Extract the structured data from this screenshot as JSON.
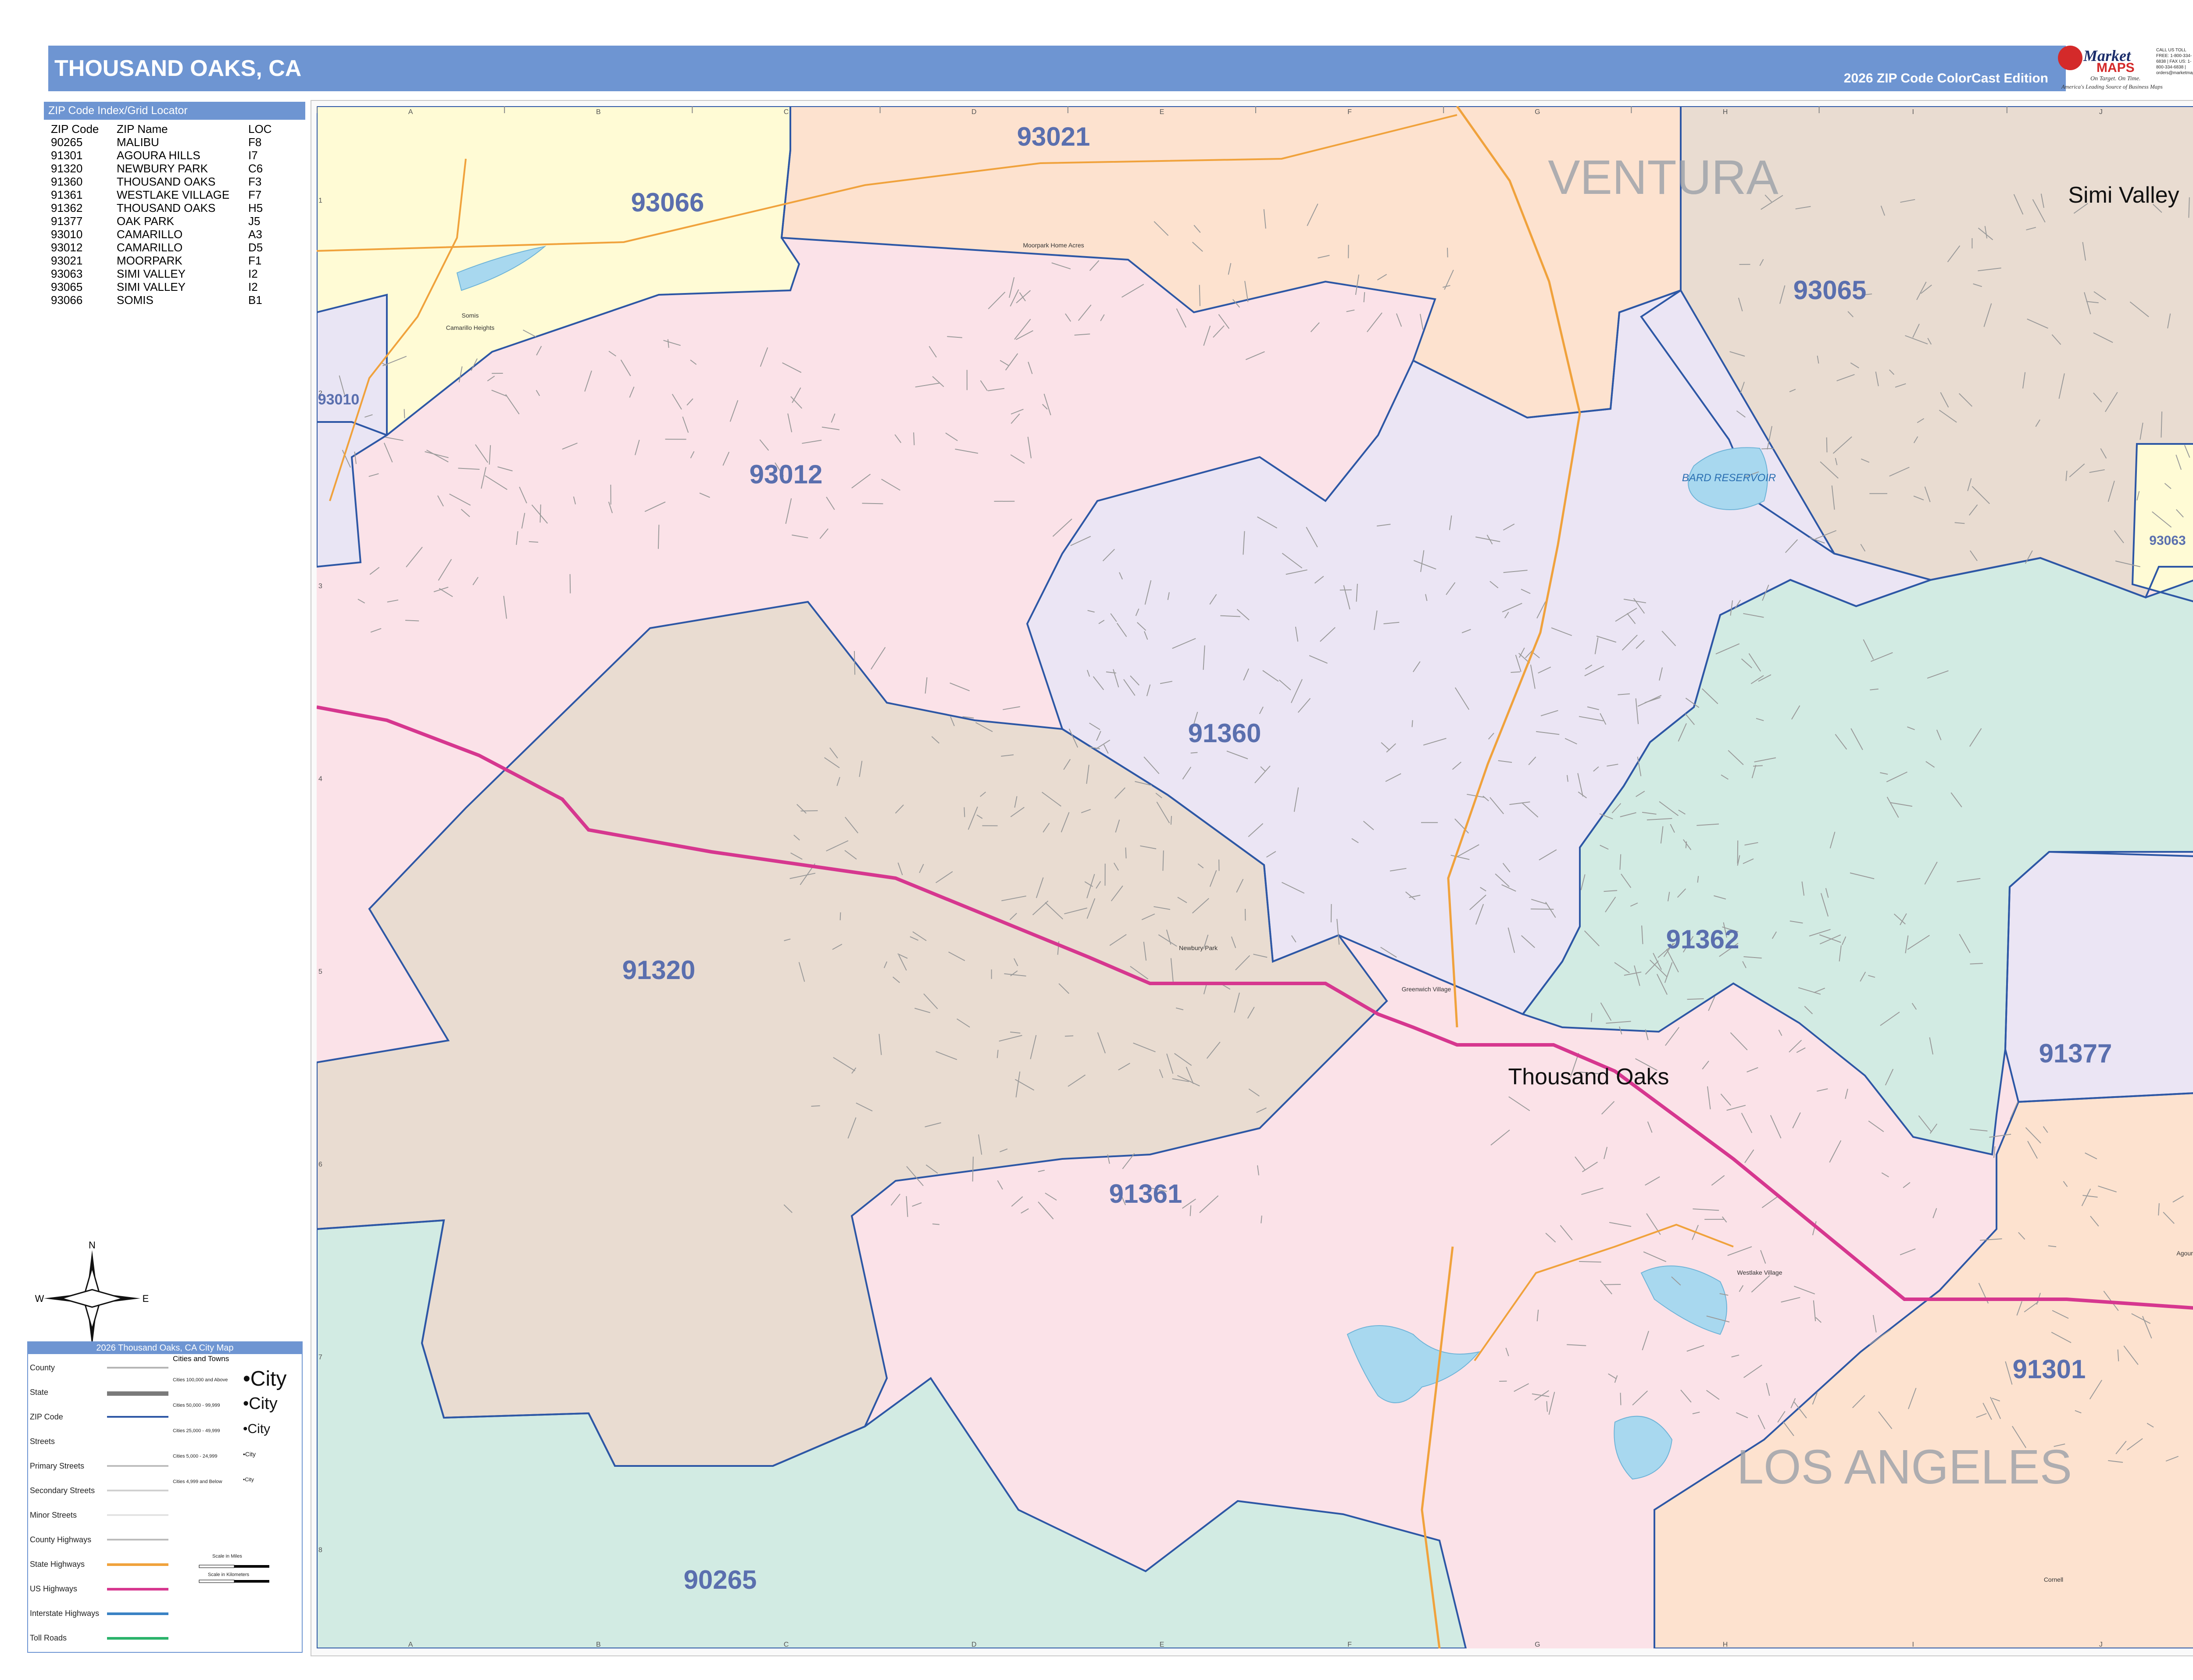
{
  "header": {
    "title": "THOUSAND OAKS, CA",
    "edition": "2026 ZIP Code ColorCast Edition"
  },
  "brand": {
    "logo_word": "Market",
    "logo_maps": "MAPS",
    "tagline": "On Target. On Time.",
    "tagline2": "America's Leading Source of Business Maps",
    "contact": "CALL US TOLL FREE: 1-800-334-6838 | FAX US: 1-800-334-6838 | orders@marketmaps.com"
  },
  "index": {
    "header": "ZIP Code Index/Grid Locator",
    "columns": [
      "ZIP Code",
      "ZIP Name",
      "LOC"
    ],
    "rows": [
      [
        "90265",
        "MALIBU",
        "F8"
      ],
      [
        "91301",
        "AGOURA HILLS",
        "I7"
      ],
      [
        "91320",
        "NEWBURY PARK",
        "C6"
      ],
      [
        "91360",
        "THOUSAND OAKS",
        "F3"
      ],
      [
        "91361",
        "WESTLAKE VILLAGE",
        "F7"
      ],
      [
        "91362",
        "THOUSAND OAKS",
        "H5"
      ],
      [
        "91377",
        "OAK PARK",
        "J5"
      ],
      [
        "93010",
        "CAMARILLO",
        "A3"
      ],
      [
        "93012",
        "CAMARILLO",
        "D5"
      ],
      [
        "93021",
        "MOORPARK",
        "F1"
      ],
      [
        "93063",
        "SIMI VALLEY",
        "I2"
      ],
      [
        "93065",
        "SIMI VALLEY",
        "I2"
      ],
      [
        "93066",
        "SOMIS",
        "B1"
      ]
    ]
  },
  "map": {
    "grid_cols": [
      "A",
      "B",
      "C",
      "D",
      "E",
      "F",
      "G",
      "H",
      "I",
      "J"
    ],
    "grid_rows": [
      "1",
      "2",
      "3",
      "4",
      "5",
      "6",
      "7",
      "8"
    ],
    "zip_labels": [
      {
        "zip": "93021",
        "color": "#5a6fae"
      },
      {
        "zip": "93066",
        "color": "#5a6fae"
      },
      {
        "zip": "93065",
        "color": "#5a6fae"
      },
      {
        "zip": "93010",
        "color": "#5a6fae"
      },
      {
        "zip": "93012",
        "color": "#5a6fae"
      },
      {
        "zip": "93063",
        "color": "#5a6fae"
      },
      {
        "zip": "91360",
        "color": "#5a6fae"
      },
      {
        "zip": "91362",
        "color": "#5a6fae"
      },
      {
        "zip": "91320",
        "color": "#5a6fae"
      },
      {
        "zip": "91377",
        "color": "#5a6fae"
      },
      {
        "zip": "91361",
        "color": "#5a6fae"
      },
      {
        "zip": "91301",
        "color": "#5a6fae"
      },
      {
        "zip": "90265",
        "color": "#5a6fae"
      }
    ],
    "county_labels": [
      "VENTURA",
      "LOS ANGELES"
    ],
    "city_labels": [
      "Simi Valley",
      "Thousand Oaks"
    ],
    "small_places": [
      "Moorpark Home Acres",
      "Somis",
      "Camarillo Heights",
      "Newbury Park",
      "Greenwich Village",
      "Westlake Village",
      "Cornell",
      "Agoura H"
    ],
    "water_labels": [
      "BARD RESERVOIR"
    ],
    "colors": {
      "z93066": "#fffbd5",
      "z93021": "#fde2cf",
      "z93065": "#e9dcd1",
      "z93010": "#e9e5f4",
      "z93012": "#fbe2e8",
      "z93063": "#fffbd5",
      "z91360": "#ebe5f4",
      "z91362": "#d2ebe3",
      "z91320": "#e9dcd1",
      "z91377": "#ebe5f4",
      "z91361": "#fbe2e8",
      "z91301": "#fde2cf",
      "z90265": "#d2ebe3",
      "boundary": "#2d57a5",
      "us_hwy": "#d6378f",
      "state_hwy": "#f0a23c",
      "water": "#a8d8ef"
    }
  },
  "legend": {
    "header": "2026 Thousand Oaks, CA City Map",
    "items": [
      "County",
      "State",
      "ZIP Code",
      "Streets",
      "Primary Streets",
      "Secondary Streets",
      "Minor Streets",
      "County Highways",
      "State Highways",
      "US Highways",
      "Interstate Highways",
      "Toll Roads"
    ],
    "cities_title": "Cities and Towns",
    "city_classes": [
      {
        "label": "Cities 100,000 and Above",
        "sample": "•City"
      },
      {
        "label": "Cities 50,000 - 99,999",
        "sample": "•City"
      },
      {
        "label": "Cities 25,000 - 49,999",
        "sample": "•City"
      },
      {
        "label": "Cities 5,000 - 24,999",
        "sample": "•City"
      },
      {
        "label": "Cities 4,999 and Below",
        "sample": "•City"
      }
    ],
    "scale_miles": "Scale in Miles",
    "scale_km": "Scale in Kilometers"
  },
  "compass": {
    "n": "N",
    "s": "S",
    "e": "E",
    "w": "W"
  }
}
